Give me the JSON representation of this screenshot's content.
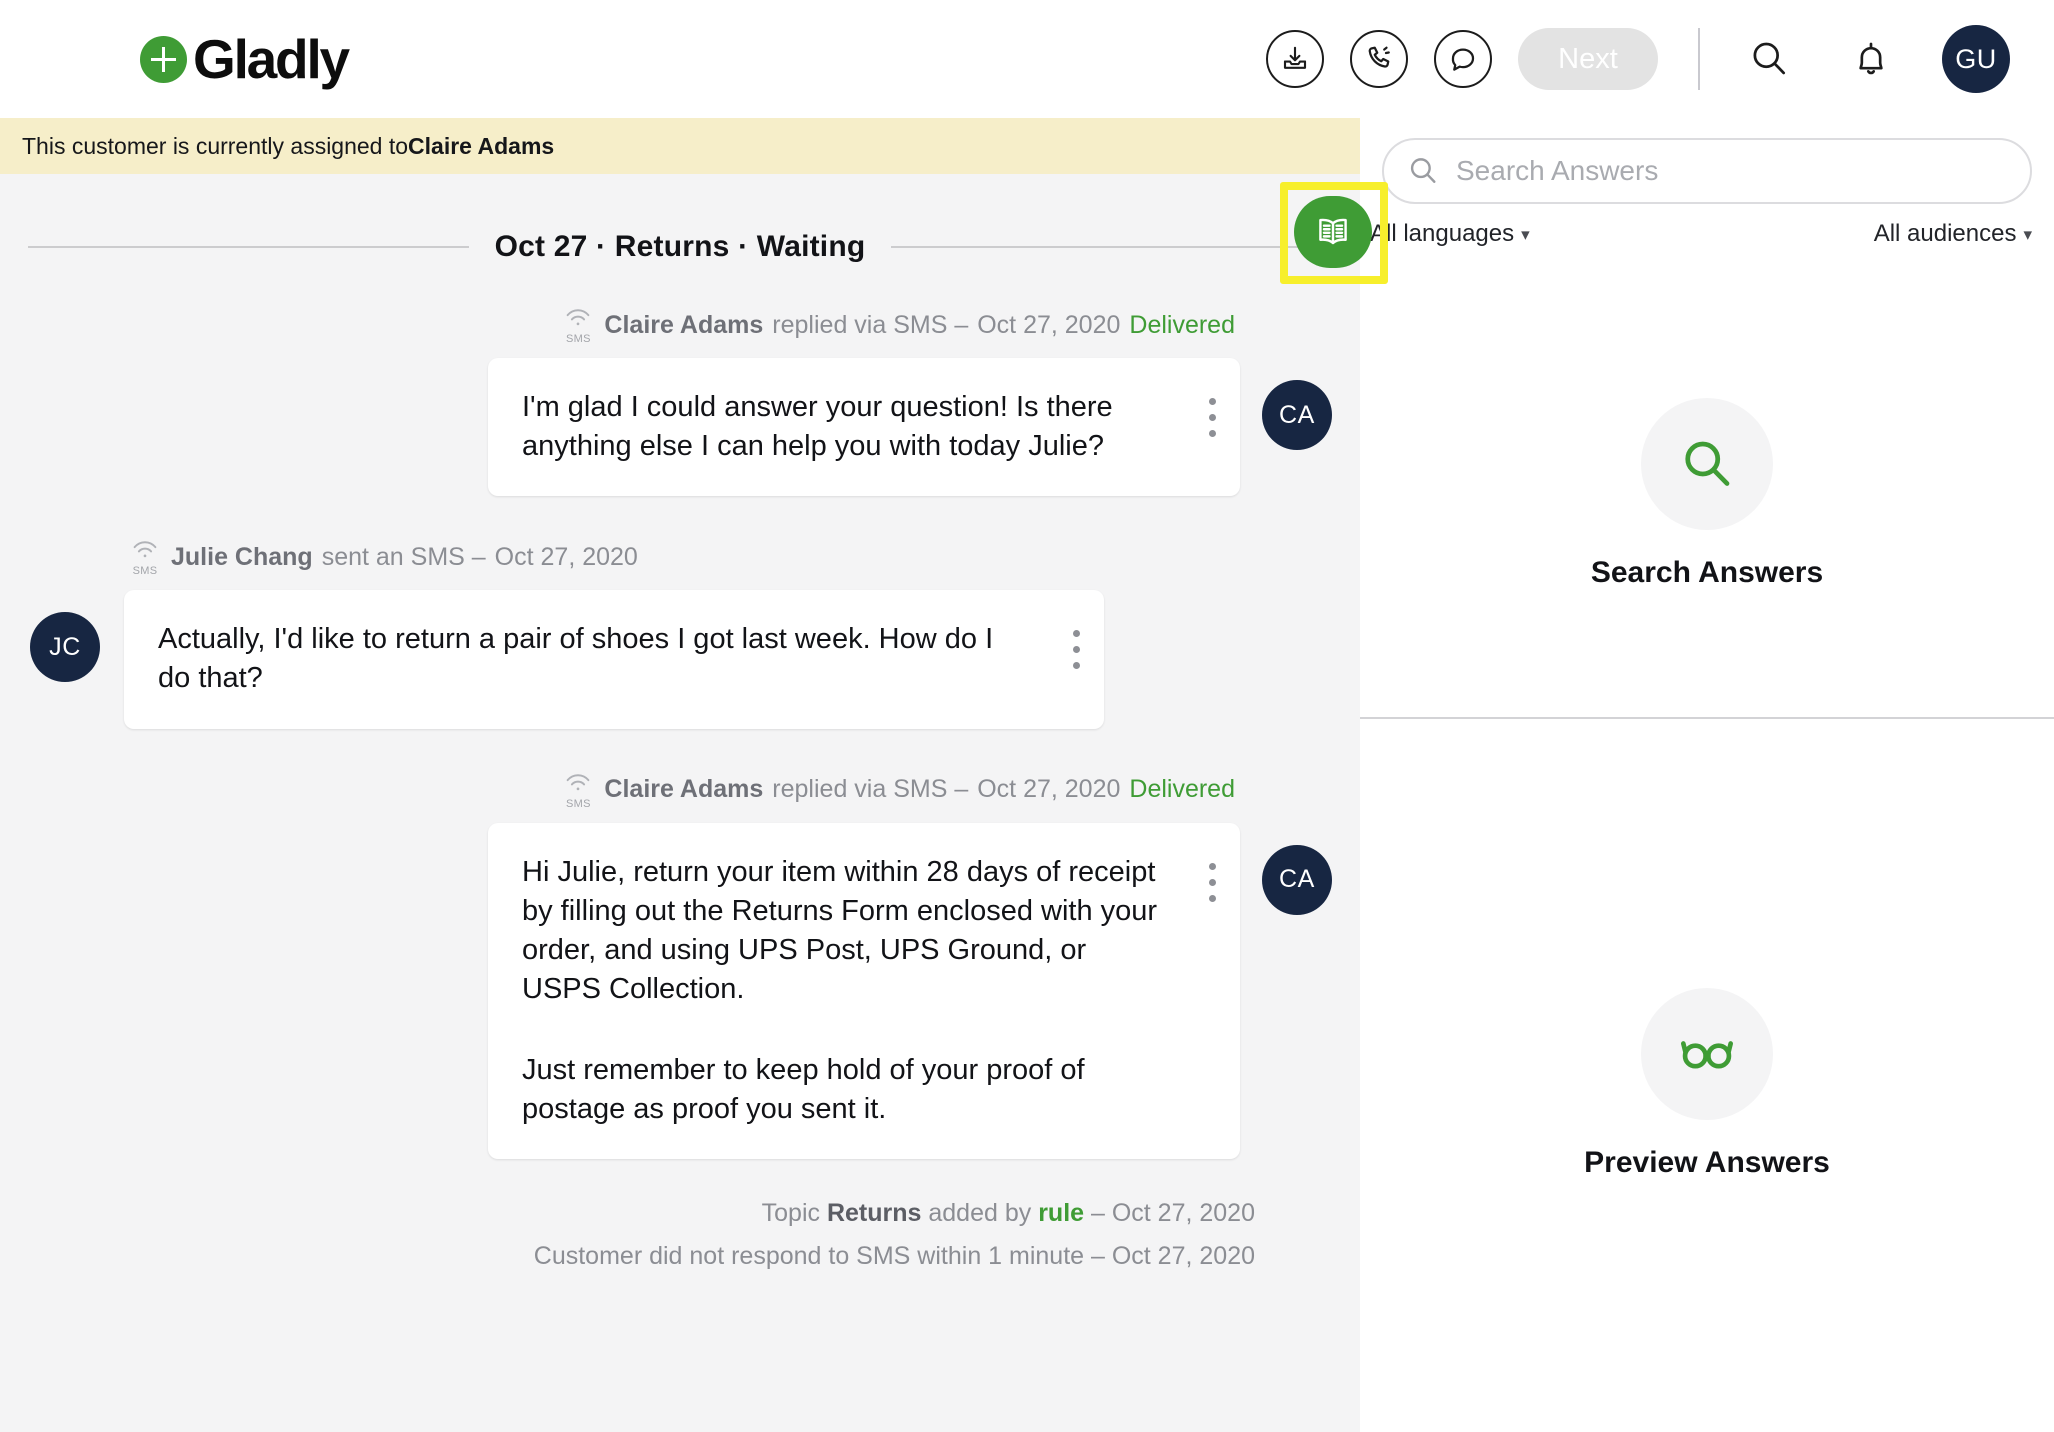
{
  "brand": {
    "name": "Gladly",
    "green": "#3f9c35",
    "navy": "#172642",
    "highlight_yellow": "#f7ef2c"
  },
  "topbar": {
    "logo_text": "Gladly",
    "actions": [
      {
        "name": "inbox-download-icon",
        "label": ""
      },
      {
        "name": "phone-call-icon",
        "label": ""
      },
      {
        "name": "chat-bubble-icon",
        "label": ""
      }
    ],
    "next_label": "Next",
    "search_icon": "search-icon",
    "bell_icon": "bell-icon",
    "user_initials": "GU"
  },
  "banner": {
    "prefix": "This customer is currently assigned to ",
    "agent": "Claire Adams"
  },
  "conversation": {
    "title": "Oct 27 · Returns · Waiting",
    "messages": [
      {
        "direction": "outbound",
        "channel_icon": "sms-icon",
        "channel_label": "SMS",
        "author": "Claire Adams",
        "action": " replied via SMS – ",
        "date": "Oct 27, 2020",
        "status": "Delivered",
        "avatar": "CA",
        "paragraphs": [
          "I'm glad I could answer your question! Is there anything else I can help you with today Julie?"
        ]
      },
      {
        "direction": "inbound",
        "channel_icon": "sms-icon",
        "channel_label": "SMS",
        "author": "Julie Chang",
        "action": " sent an SMS – ",
        "date": "Oct 27, 2020",
        "status": "",
        "avatar": "JC",
        "paragraphs": [
          "Actually, I'd like to return a pair of shoes I got last week. How do I do that?"
        ]
      },
      {
        "direction": "outbound",
        "channel_icon": "sms-icon",
        "channel_label": "SMS",
        "author": "Claire Adams",
        "action": " replied via SMS – ",
        "date": "Oct 27, 2020",
        "status": "Delivered",
        "avatar": "CA",
        "paragraphs": [
          "Hi Julie, return your item within 28 days of receipt by filling out the Returns Form enclosed with your order, and using UPS Post, UPS Ground, or USPS Collection.",
          "Just remember to keep hold of your proof of postage as proof you sent it."
        ]
      }
    ],
    "system_events": {
      "topic_prefix": "Topic ",
      "topic_name": "Returns",
      "topic_middle": " added by ",
      "topic_source": "rule",
      "topic_suffix": " – Oct 27, 2020",
      "no_response": "Customer did not respond to SMS within 1 minute – Oct 27, 2020"
    }
  },
  "book_toggle": {
    "name": "answers-book-toggle",
    "icon": "open-book-icon"
  },
  "answers_panel": {
    "search": {
      "placeholder": "Search Answers",
      "value": ""
    },
    "filters": {
      "language": "All languages",
      "audience": "All audiences"
    },
    "sections": [
      {
        "icon": "search-icon",
        "label": "Search Answers"
      },
      {
        "icon": "glasses-icon",
        "label": "Preview Answers"
      }
    ]
  }
}
